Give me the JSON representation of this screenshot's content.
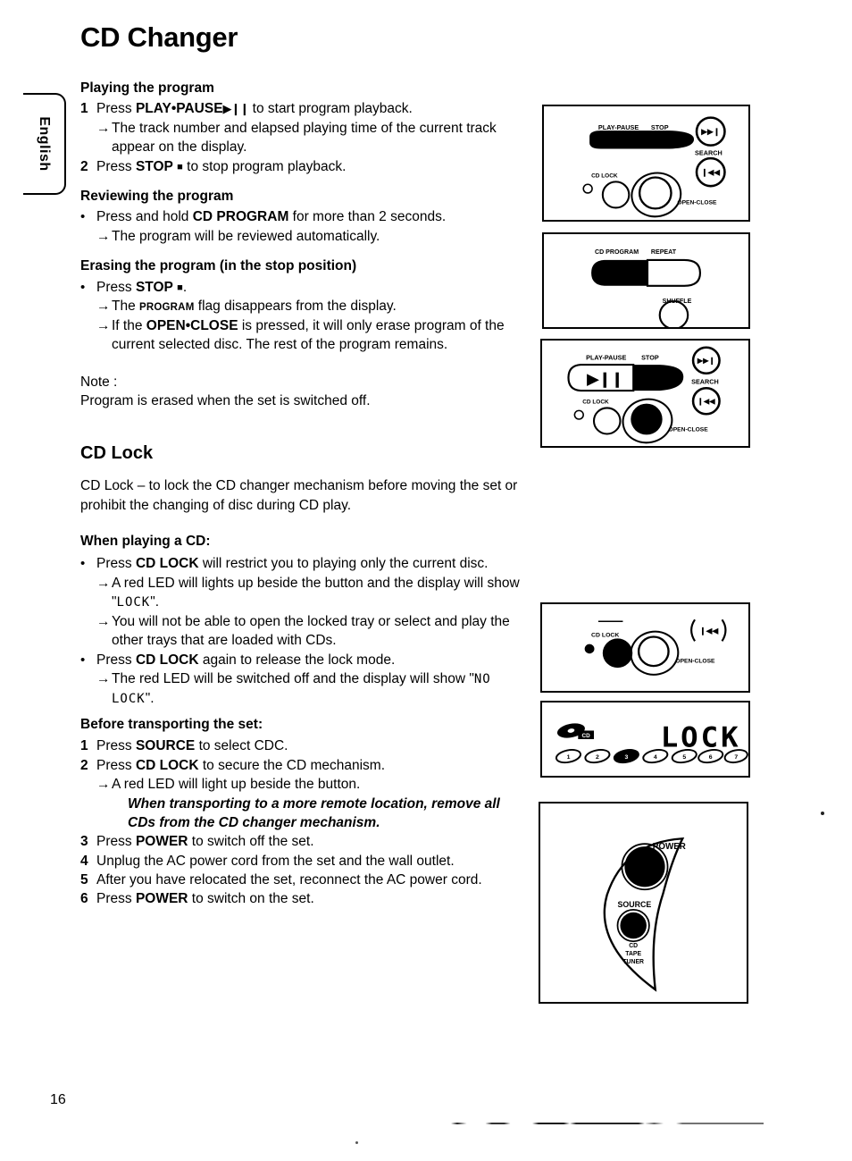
{
  "page": {
    "title": "CD Changer",
    "language_tab": "English",
    "page_number": "16"
  },
  "sections": [
    {
      "heading": "Playing the program",
      "steps": [
        {
          "marker": "1",
          "text_before": "Press ",
          "bold": "PLAY•PAUSE",
          "glyph": "▶❙❙",
          "text_after": " to start program playback."
        },
        {
          "marker": "→",
          "text": "The track number and elapsed playing time of the current track appear on the display."
        },
        {
          "marker": "2",
          "text_before": "Press ",
          "bold": "STOP",
          "glyph": "■",
          "text_after": " to stop program playback."
        }
      ]
    },
    {
      "heading": "Reviewing the program",
      "steps": [
        {
          "marker": "•",
          "text_before": "Press and hold ",
          "bold": "CD PROGRAM",
          "text_after": " for more than 2 seconds."
        },
        {
          "marker": "→",
          "text": "The program will be reviewed automatically."
        }
      ]
    },
    {
      "heading": "Erasing the program (in the stop position)",
      "steps": [
        {
          "marker": "•",
          "text_before": "Press ",
          "bold": "STOP",
          "glyph": "■",
          "text_after": "."
        },
        {
          "marker": "→",
          "text_before": "The ",
          "smallcaps": "PROGRAM",
          "text_after": " flag disappears from the display."
        },
        {
          "marker": "→",
          "text_before": "If the ",
          "bold": "OPEN•CLOSE",
          "text_after": " is pressed, it will only erase program of the current selected disc. The rest of the program remains."
        }
      ]
    }
  ],
  "note": {
    "label": "Note :",
    "text": "Program is erased when the set is switched off."
  },
  "cd_lock": {
    "heading": "CD Lock",
    "intro": "CD Lock – to lock the CD changer mechanism before moving the set or prohibit the changing of disc during CD play.",
    "when_playing": {
      "heading": "When playing a CD:",
      "items": [
        {
          "marker": "•",
          "text_before": "Press ",
          "bold": "CD LOCK",
          "text_after": " will restrict you to playing only the current disc."
        },
        {
          "marker": "→",
          "text_before": "A red LED will lights up beside the button and the display will show \"",
          "lcd": "LOCK",
          "text_after": "\"."
        },
        {
          "marker": "→",
          "text": "You will not be able to open the locked tray or select and play the other trays that are loaded with CDs."
        },
        {
          "marker": "•",
          "text_before": "Press ",
          "bold": "CD LOCK",
          "text_after": " again to release the lock mode."
        },
        {
          "marker": "→",
          "text_before": "The red LED will be switched off and the display will show \"",
          "lcd": "NO LOCK",
          "text_after": "\"."
        }
      ]
    },
    "before_transporting": {
      "heading": "Before transporting the set:",
      "items": [
        {
          "marker": "1",
          "text_before": "Press ",
          "bold": "SOURCE",
          "text_after": " to select CDC."
        },
        {
          "marker": "2",
          "text_before": "Press ",
          "bold": "CD LOCK",
          "text_after": " to secure the CD mechanism."
        },
        {
          "marker": "→",
          "text": "A red LED will light up beside the button."
        },
        {
          "marker": "",
          "italic_bold": "When transporting to a more remote location, remove all CDs from the CD changer mechanism."
        },
        {
          "marker": "3",
          "text_before": "Press ",
          "bold": "POWER",
          "text_after": " to switch off the set."
        },
        {
          "marker": "4",
          "text": "Unplug the AC power cord from the set and the wall outlet."
        },
        {
          "marker": "5",
          "text": "After you have relocated the set, reconnect the AC power cord."
        },
        {
          "marker": "6",
          "text_before": "Press ",
          "bold": "POWER",
          "text_after": " to switch on the set."
        }
      ]
    }
  },
  "illustrations": {
    "panel_1": {
      "name": "front-panel-play-stop-bar",
      "labels": {
        "play_pause": "PLAY-PAUSE",
        "stop": "STOP",
        "search": "SEARCH",
        "cd_lock": "CD LOCK",
        "open_close": "OPEN-CLOSE",
        "next": "▶▶❙",
        "prev": "❙◀◀"
      },
      "highlight": "none"
    },
    "panel_2": {
      "name": "program-repeat-shuffle-panel",
      "labels": {
        "cd_program": "CD PROGRAM",
        "repeat": "REPEAT",
        "shuffle": "SHUFFLE"
      },
      "highlight": "cd_program"
    },
    "panel_3": {
      "name": "front-panel-stop-highlighted",
      "labels": {
        "play_pause": "PLAY-PAUSE",
        "stop": "STOP",
        "search": "SEARCH",
        "cd_lock": "CD LOCK",
        "open_close": "OPEN-CLOSE",
        "next": "▶▶❙",
        "prev": "❙◀◀",
        "play_glyph": "▶❙❙"
      },
      "highlight": "stop-and-open-close"
    },
    "panel_4": {
      "name": "cd-lock-button-panel",
      "labels": {
        "cd_lock": "CD LOCK",
        "open_close": "OPEN-CLOSE",
        "prev": "❙◀◀"
      },
      "highlight": "cd_lock"
    },
    "panel_5": {
      "name": "lcd-display-lock",
      "display_text": "LOCK",
      "cd_badge": "CD",
      "disc_indicators": [
        "1",
        "2",
        "3",
        "4",
        "5",
        "6",
        "7"
      ],
      "active_disc": "3"
    },
    "panel_6": {
      "name": "power-source-side-panel",
      "labels": {
        "power": "POWER",
        "source": "SOURCE",
        "source_modes_1": "CD",
        "source_modes_2": "TAPE",
        "source_modes_3": "TUNER"
      },
      "highlight": "power-and-source"
    }
  }
}
